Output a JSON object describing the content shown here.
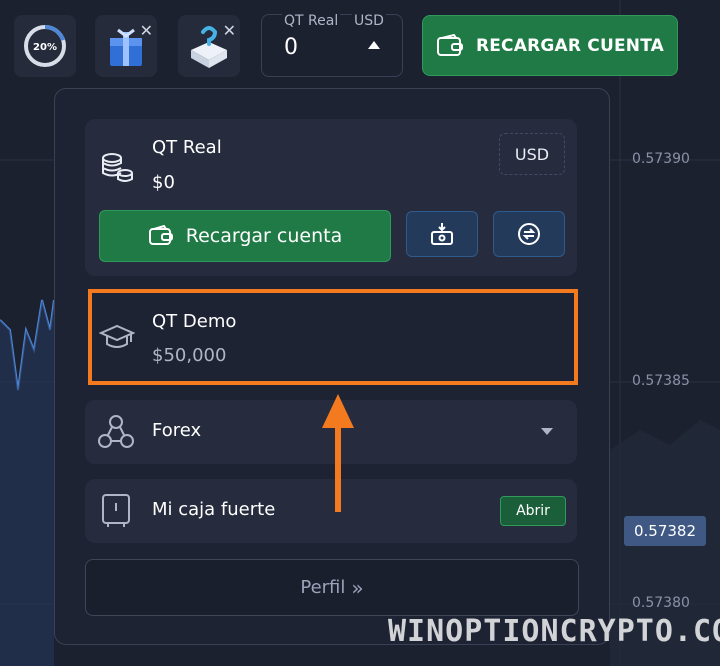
{
  "topbar": {
    "progress_label": "20%",
    "progress_fraction": 0.2,
    "account": {
      "name": "QT Real",
      "currency": "USD",
      "balance": "0"
    },
    "topup_label": "RECARGAR CUENTA"
  },
  "prices": {
    "p1": "0.57390",
    "p2": "0.57385",
    "current": "0.57382",
    "p3": "0.57380"
  },
  "panel": {
    "real": {
      "name": "QT Real",
      "balance": "$0",
      "currency": "USD",
      "topup_label": "Recargar cuenta"
    },
    "demo": {
      "name": "QT Demo",
      "balance": "$50,000"
    },
    "forex": {
      "label": "Forex"
    },
    "safe": {
      "label": "Mi caja fuerte",
      "open_label": "Abrir"
    },
    "profile": {
      "label": "Perfil",
      "chevrons": "»"
    }
  },
  "watermark": "WINOPTIONCRYPTO.COM",
  "colors": {
    "background": "#1c2130",
    "panel": "#1e2333",
    "card": "#262c3d",
    "green": "#1f7a45",
    "highlight": "#f47a1f",
    "price_badge": "#3f5884"
  },
  "icons": {
    "progress": "progress-ring-icon",
    "gift_box": "gift-box-icon",
    "mystery_box": "mystery-box-icon",
    "wallet": "wallet-icon",
    "coins": "coin-stack-icon",
    "deposit": "deposit-icon",
    "exchange": "exchange-icon",
    "graduation": "graduation-cap-icon",
    "forex": "forex-icon",
    "safe": "safe-icon"
  }
}
